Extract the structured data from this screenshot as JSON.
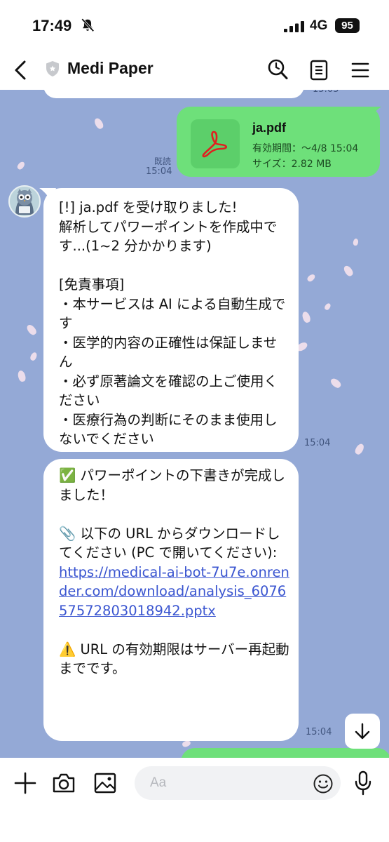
{
  "status_bar": {
    "time": "17:49",
    "network": "4G",
    "battery": "95"
  },
  "header": {
    "title": "Medi Paper"
  },
  "chat": {
    "file_message": {
      "file_name": "ja.pdf",
      "expiry": "有効期間：～4/8 15:04",
      "size": "サイズ：2.82 MB",
      "read_label": "既読",
      "time": "15:04"
    },
    "message1": {
      "text": "[!] ja.pdf を受け取りました!\n解析してパワーポイントを作成中です...(1~2 分かかります)\n\n[免責事項]\n・本サービスは AI による自動生成です\n・医学的内容の正確性は保証しません\n・必ず原著論文を確認の上ご使用ください\n・医療行為の判断にそのまま使用しないでください",
      "time": "15:04"
    },
    "message2": {
      "line_complete": "✅ パワーポイントの下書きが完成しました！",
      "line_download": "📎 以下の URL からダウンロードしてください (PC で開いてください):",
      "link": "https://medical-ai-bot-7u7e.onrender.com/download/analysis_607657572803018942.pptx",
      "line_warning": "⚠️ URL の有効期限はサーバー再起動までです。",
      "time": "15:04"
    }
  },
  "input": {
    "placeholder": "Aa"
  },
  "colors": {
    "chat_background": "#94a9d6",
    "own_bubble": "#6ee07a",
    "link": "#3a55d0",
    "pdf_icon": "#e02020"
  },
  "icons": [
    "bell-off-icon",
    "signal-icon",
    "back-icon",
    "shield-icon",
    "search-icon",
    "notes-icon",
    "menu-icon",
    "pdf-icon",
    "scroll-down-icon",
    "plus-icon",
    "camera-icon",
    "image-icon",
    "emoji-icon",
    "mic-icon"
  ]
}
